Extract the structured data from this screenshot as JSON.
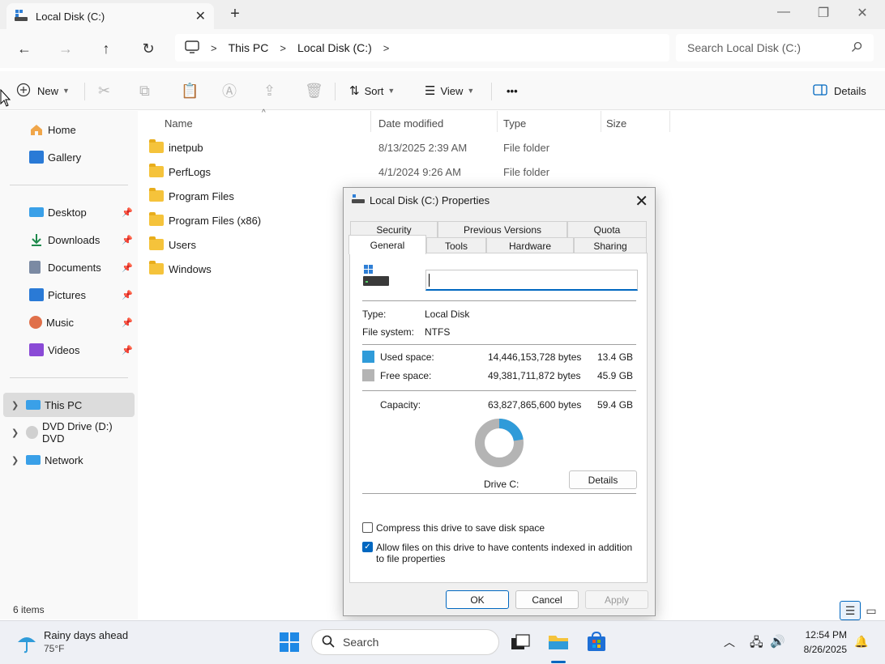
{
  "window": {
    "tab_title": "Local Disk (C:)",
    "new_tab": "+",
    "minimize": "—",
    "maximize": "❐",
    "close": "✕"
  },
  "nav": {
    "back": "←",
    "forward": "→",
    "up": "↑",
    "refresh": "↻",
    "breadcrumb": [
      "This PC",
      "Local Disk (C:)"
    ],
    "breadcrumb_sep": ">",
    "search_placeholder": "Search Local Disk (C:)"
  },
  "toolbar": {
    "new_label": "New",
    "sort_label": "Sort",
    "view_label": "View",
    "more_label": "•••",
    "details_label": "Details"
  },
  "sidebar": {
    "items": [
      {
        "label": "Home",
        "icon": "home-icon",
        "pinned": false
      },
      {
        "label": "Gallery",
        "icon": "gallery-icon",
        "pinned": false
      },
      {
        "label": "Desktop",
        "icon": "desktop-icon",
        "pinned": true
      },
      {
        "label": "Downloads",
        "icon": "downloads-icon",
        "pinned": true
      },
      {
        "label": "Documents",
        "icon": "documents-icon",
        "pinned": true
      },
      {
        "label": "Pictures",
        "icon": "pictures-icon",
        "pinned": true
      },
      {
        "label": "Music",
        "icon": "music-icon",
        "pinned": true
      },
      {
        "label": "Videos",
        "icon": "videos-icon",
        "pinned": true
      },
      {
        "label": "This PC",
        "icon": "this-pc-icon",
        "selected": true
      },
      {
        "label": "DVD Drive (D:) DVD",
        "icon": "dvd-icon"
      },
      {
        "label": "Network",
        "icon": "network-icon"
      }
    ]
  },
  "files": {
    "columns": [
      "Name",
      "Date modified",
      "Type",
      "Size"
    ],
    "rows": [
      {
        "name": "inetpub",
        "date": "8/13/2025 2:39 AM",
        "type": "File folder"
      },
      {
        "name": "PerfLogs",
        "date": "4/1/2024 9:26 AM",
        "type": "File folder"
      },
      {
        "name": "Program Files",
        "date": "",
        "type": ""
      },
      {
        "name": "Program Files (x86)",
        "date": "",
        "type": ""
      },
      {
        "name": "Users",
        "date": "",
        "type": ""
      },
      {
        "name": "Windows",
        "date": "",
        "type": ""
      }
    ],
    "item_count": "6 items"
  },
  "dialog": {
    "title": "Local Disk (C:) Properties",
    "tabs_top": [
      "Security",
      "Previous Versions",
      "Quota"
    ],
    "tabs_bottom": [
      "General",
      "Tools",
      "Hardware",
      "Sharing"
    ],
    "type_label": "Type:",
    "type_value": "Local Disk",
    "fs_label": "File system:",
    "fs_value": "NTFS",
    "used_label": "Used space:",
    "used_bytes": "14,446,153,728 bytes",
    "used_gb": "13.4 GB",
    "free_label": "Free space:",
    "free_bytes": "49,381,711,872 bytes",
    "free_gb": "45.9 GB",
    "capacity_label": "Capacity:",
    "capacity_bytes": "63,827,865,600 bytes",
    "capacity_gb": "59.4 GB",
    "used_fraction": 0.2263,
    "used_color": "#2f9bd9",
    "free_color": "#b4b4b4",
    "drive_label": "Drive C:",
    "details_btn": "Details",
    "compress_label": "Compress this drive to save disk space",
    "compress_checked": false,
    "index_label": "Allow files on this drive to have contents indexed in addition to file properties",
    "index_checked": true,
    "ok": "OK",
    "cancel": "Cancel",
    "apply": "Apply"
  },
  "taskbar": {
    "weather_title": "Rainy days ahead",
    "weather_temp": "75°F",
    "search_label": "Search",
    "time": "12:54 PM",
    "date": "8/26/2025"
  },
  "colors": {
    "accent": "#0067c0",
    "folder": "#f5c33b"
  }
}
